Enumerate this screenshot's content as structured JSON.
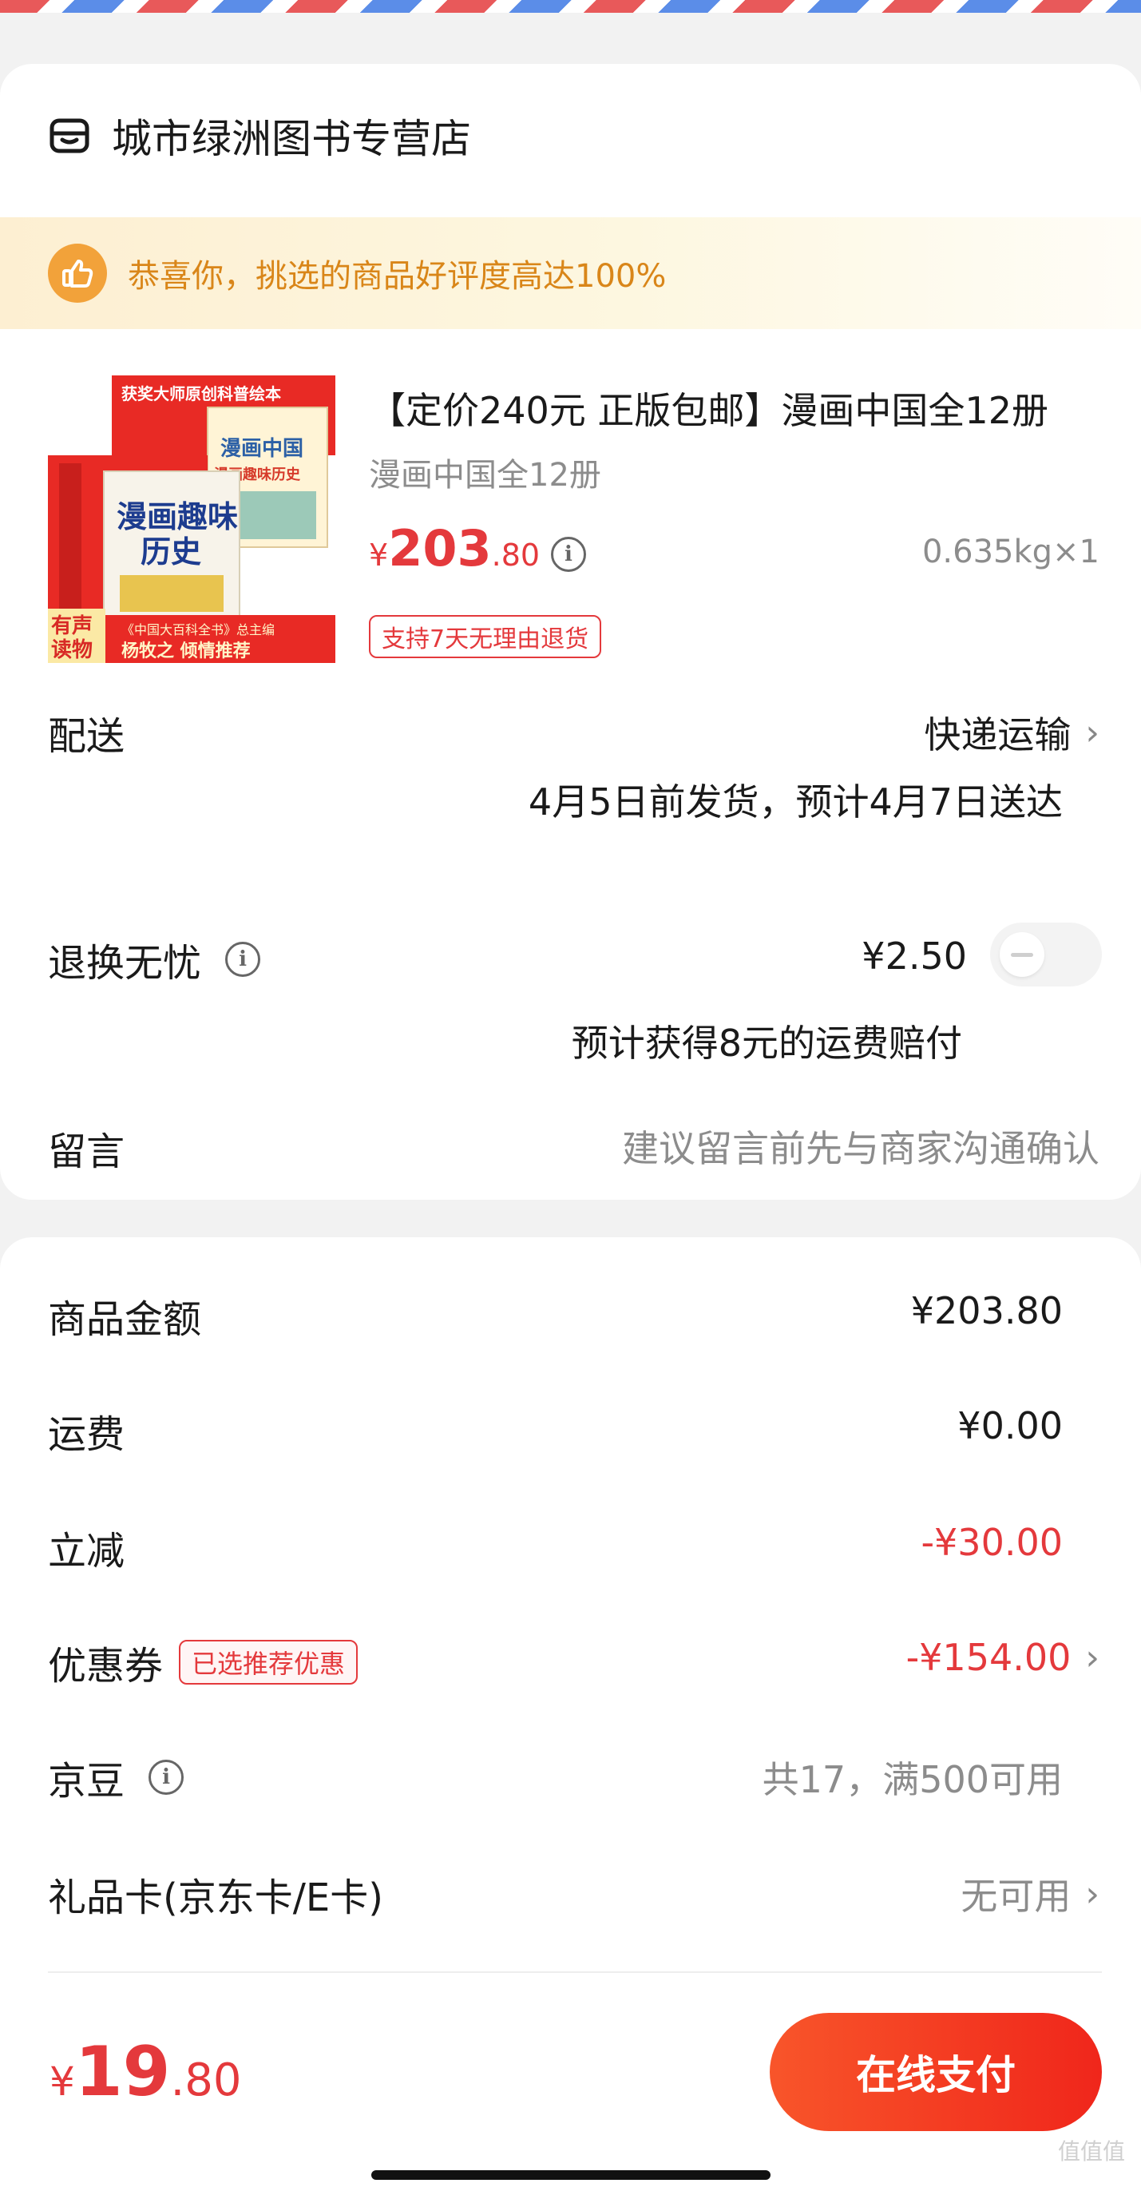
{
  "store": {
    "name": "城市绿洲图书专营店"
  },
  "banner": {
    "text": "恭喜你，挑选的商品好评度高达100%"
  },
  "product": {
    "title": "【定价240元 正版包邮】漫画中国全12册",
    "variant": "漫画中国全12册",
    "price_currency": "¥",
    "price_int": "203",
    "price_dec": ".80",
    "weight_qty": "0.635kg×1",
    "return_tag": "支持7天无理由退货",
    "cover": {
      "top_text": "获奖大师原创科普绘本",
      "book1_title": "漫画中国",
      "book1_sub": "漫画趣味历史",
      "book2_title": "漫画趣味",
      "book2_title2": "历史",
      "ribbon1": "有声",
      "ribbon2": "读物",
      "author_line": "《中国大百科全书》总主编",
      "author": "杨牧之 倾情推荐"
    }
  },
  "delivery": {
    "label": "配送",
    "method": "快递运输",
    "estimate": "4月5日前发货，预计4月7日送达"
  },
  "return_insurance": {
    "label": "退换无忧",
    "price": "¥2.50",
    "note": "预计获得8元的运费赔付",
    "enabled": false
  },
  "message": {
    "label": "留言",
    "placeholder": "建议留言前先与商家沟通确认"
  },
  "summary": {
    "goods_label": "商品金额",
    "goods_value": "¥203.80",
    "shipping_label": "运费",
    "shipping_value": "¥0.00",
    "discount_label": "立减",
    "discount_value": "-¥30.00",
    "coupon_label": "优惠券",
    "coupon_badge": "已选推荐优惠",
    "coupon_value": "-¥154.00",
    "jingdou_label": "京豆",
    "jingdou_value": "共17，满500可用",
    "giftcard_label": "礼品卡(京东卡/E卡)",
    "giftcard_value": "无可用"
  },
  "footer": {
    "total_currency": "¥",
    "total_int": "19",
    "total_dec": ".80",
    "pay_button": "在线支付",
    "watermark": "值值值"
  },
  "colors": {
    "accent_red": "#e4393c",
    "banner_orange": "#d98619",
    "pay_gradient_start": "#f8552a",
    "pay_gradient_end": "#f0261b"
  }
}
